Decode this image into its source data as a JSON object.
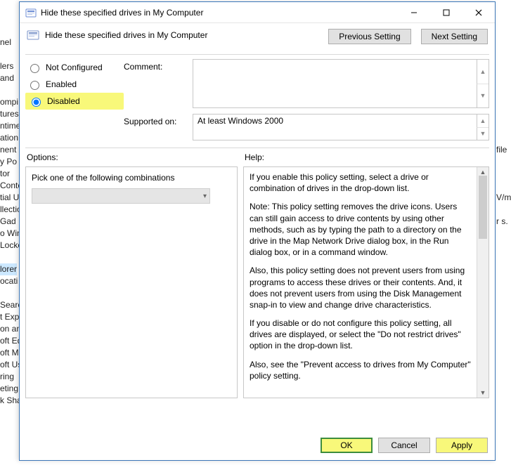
{
  "bg_left": [
    "nel",
    "",
    "lers",
    "and",
    "",
    "ompi",
    "tures",
    "ntime",
    "ation C",
    "nent",
    "y Po",
    "tor",
    "Conte",
    "tial U",
    "llectio",
    "Gad",
    "o Win",
    "Locke",
    "",
    "lorer",
    "ocati",
    "",
    "Searc",
    "t Expl",
    "on and",
    "oft Ed",
    "oft M",
    "oft Us",
    "ring",
    "eting",
    "k Sha"
  ],
  "bg_right": [
    "",
    "",
    "",
    "",
    "",
    "",
    "",
    "",
    "",
    "file",
    "",
    "",
    "",
    "V/m",
    "",
    "r s.",
    "",
    "",
    "",
    "",
    "",
    "",
    "",
    "",
    "",
    "",
    "",
    "",
    "",
    "",
    ""
  ],
  "window": {
    "title": "Hide these specified drives in My Computer",
    "subtitle": "Hide these specified drives in My Computer",
    "prev": "Previous Setting",
    "next": "Next Setting",
    "radios": {
      "not_configured": "Not Configured",
      "enabled": "Enabled",
      "disabled": "Disabled"
    },
    "comment_label": "Comment:",
    "supported_label": "Supported on:",
    "supported_value": "At least Windows 2000",
    "options_label": "Options:",
    "help_label": "Help:",
    "options_text": "Pick one of the following combinations",
    "help_paragraphs": [
      "If you enable this policy setting, select a drive or combination of drives in the drop-down list.",
      "Note: This policy setting removes the drive icons. Users can still gain access to drive contents by using other methods, such as by typing the path to a directory on the drive in the Map Network Drive dialog box, in the Run dialog box, or in a command window.",
      "Also, this policy setting does not prevent users from using programs to access these drives or their contents. And, it does not prevent users from using the Disk Management snap-in to view and change drive characteristics.",
      "If you disable or do not configure this policy setting, all drives are displayed, or select the \"Do not restrict drives\" option in the drop-down list.",
      "Also, see the \"Prevent access to drives from My Computer\" policy setting."
    ],
    "ok": "OK",
    "cancel": "Cancel",
    "apply": "Apply"
  }
}
